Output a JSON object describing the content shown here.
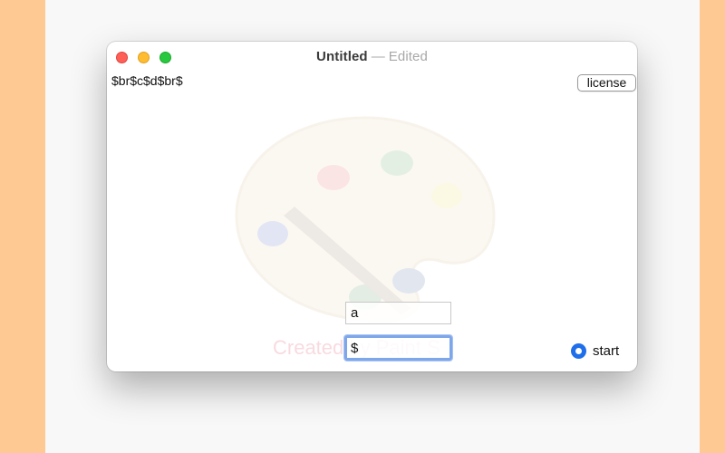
{
  "window": {
    "title": "Untitled",
    "title_separator": "—",
    "title_status": "Edited"
  },
  "canvas": {
    "label_text": "$br$c$d$br$",
    "license_button": "license",
    "watermark": "Created by Paint S",
    "field_a_value": "a",
    "field_b_value": "$",
    "radio": {
      "label": "start",
      "selected": true
    }
  },
  "colors": {
    "outer_background": "#ffc993",
    "accent_blue": "#1f6fea"
  },
  "icons": {
    "background_graphic": "paint-palette-icon"
  }
}
